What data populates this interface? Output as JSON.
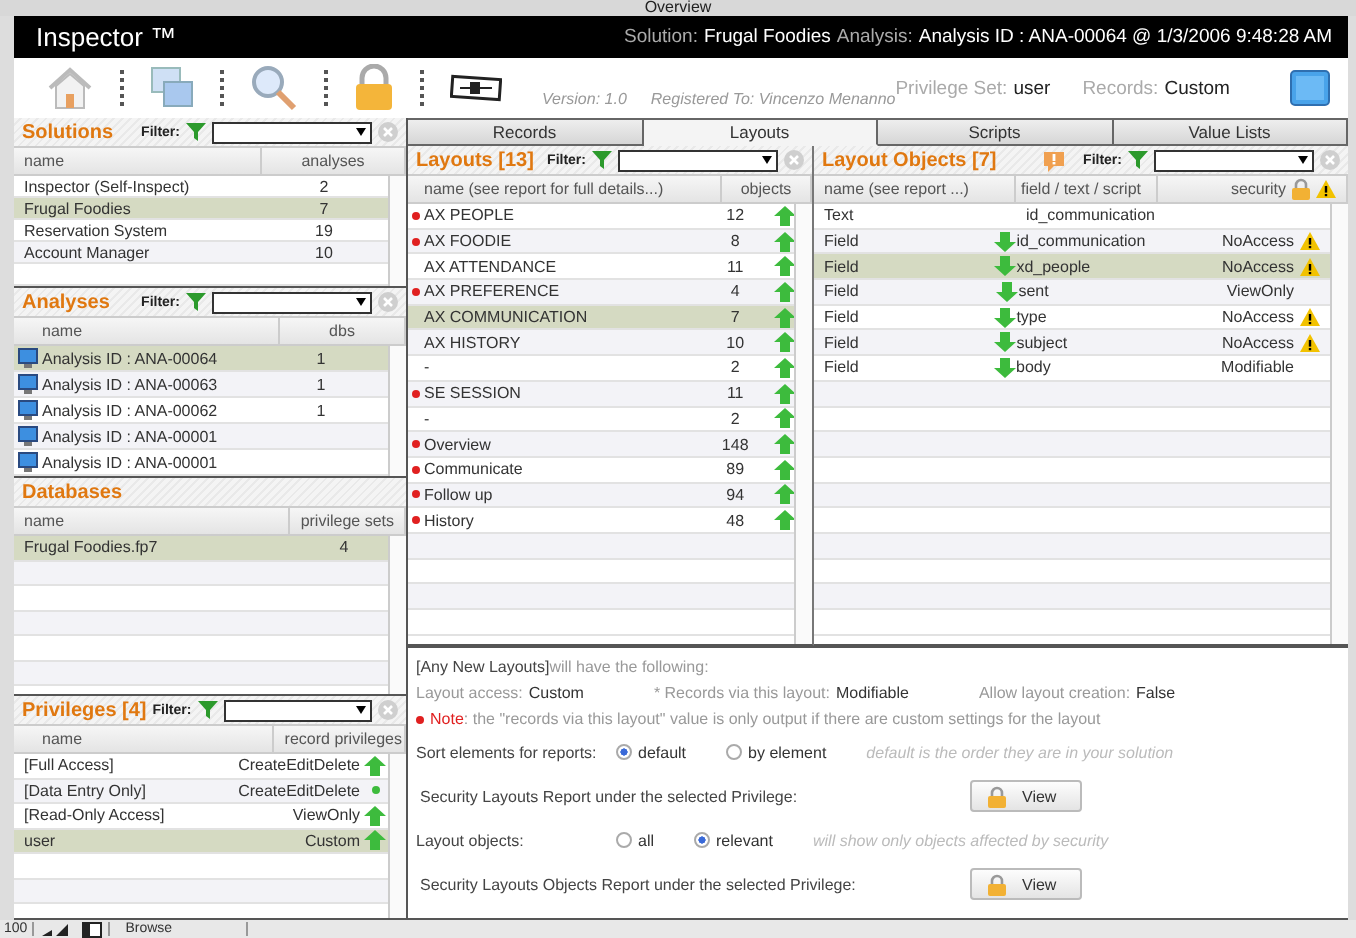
{
  "window": {
    "title": "Overview"
  },
  "header": {
    "app_title": "Inspector ™",
    "solution_label": "Solution:",
    "solution": "Frugal Foodies",
    "analysis_label": "Analysis:",
    "analysis": "Analysis ID : ANA-00064 @ 1/3/2006 9:48:28 AM"
  },
  "toolbar": {
    "version": "Version: 1.0",
    "registered": "Registered To: Vincenzo Menanno",
    "privilege_set_label": "Privilege Set:",
    "privilege_set": "user",
    "records_label": "Records:",
    "records": "Custom"
  },
  "solutions": {
    "title": "Solutions",
    "filter_label": "Filter:",
    "columns": [
      "name",
      "analyses"
    ],
    "rows": [
      {
        "name": "Inspector (Self-Inspect)",
        "count": "2",
        "selected": false
      },
      {
        "name": "Frugal Foodies",
        "count": "7",
        "selected": true
      },
      {
        "name": "Reservation System",
        "count": "19",
        "selected": false
      },
      {
        "name": "Account Manager",
        "count": "10",
        "selected": false
      }
    ]
  },
  "analyses": {
    "title": "Analyses",
    "filter_label": "Filter:",
    "columns": [
      "name",
      "dbs"
    ],
    "rows": [
      {
        "name": "Analysis ID : ANA-00064",
        "count": "1",
        "selected": true
      },
      {
        "name": "Analysis ID : ANA-00063",
        "count": "1",
        "selected": false
      },
      {
        "name": "Analysis ID : ANA-00062",
        "count": "1",
        "selected": false
      },
      {
        "name": "Analysis ID : ANA-00001",
        "selected": false
      },
      {
        "name": "Analysis ID : ANA-00001",
        "selected": false
      }
    ]
  },
  "databases": {
    "title": "Databases",
    "columns": [
      "name",
      "privilege sets"
    ],
    "rows": [
      {
        "name": "Frugal Foodies.fp7",
        "count": "4",
        "selected": true
      }
    ]
  },
  "privileges": {
    "title": "Privileges [4]",
    "filter_label": "Filter:",
    "columns": [
      "name",
      "record privileges"
    ],
    "rows": [
      {
        "name": "[Full Access]",
        "value": "CreateEditDelete",
        "kind": "arrow",
        "selected": false
      },
      {
        "name": "[Data Entry Only]",
        "value": "CreateEditDelete",
        "kind": "dot",
        "selected": false
      },
      {
        "name": "[Read-Only Access]",
        "value": "ViewOnly",
        "kind": "arrow",
        "selected": false
      },
      {
        "name": "user",
        "value": "Custom",
        "kind": "arrow",
        "selected": true
      }
    ]
  },
  "tabs": [
    {
      "label": "Records",
      "selected": false
    },
    {
      "label": "Layouts",
      "selected": true
    },
    {
      "label": "Scripts",
      "selected": false
    },
    {
      "label": "Value Lists",
      "selected": false
    }
  ],
  "layouts": {
    "title": "Layouts [13]",
    "filter_label": "Filter:",
    "columns": [
      "name (see report for full details...)",
      "objects"
    ],
    "rows": [
      {
        "name": "AX PEOPLE",
        "objects": "12",
        "flagged": true,
        "selected": false
      },
      {
        "name": "AX FOODIE",
        "objects": "8",
        "flagged": true,
        "selected": false
      },
      {
        "name": "AX ATTENDANCE",
        "objects": "11",
        "flagged": false,
        "selected": false
      },
      {
        "name": "AX PREFERENCE",
        "objects": "4",
        "flagged": true,
        "selected": false
      },
      {
        "name": "AX COMMUNICATION",
        "objects": "7",
        "flagged": false,
        "selected": true
      },
      {
        "name": "AX HISTORY",
        "objects": "10",
        "flagged": false,
        "selected": false
      },
      {
        "name": "-",
        "objects": "2",
        "flagged": false,
        "selected": false
      },
      {
        "name": "SE SESSION",
        "objects": "11",
        "flagged": true,
        "selected": false
      },
      {
        "name": "-",
        "objects": "2",
        "flagged": false,
        "selected": false
      },
      {
        "name": "Overview",
        "objects": "148",
        "flagged": true,
        "selected": false
      },
      {
        "name": "Communicate",
        "objects": "89",
        "flagged": true,
        "selected": false
      },
      {
        "name": "Follow up",
        "objects": "94",
        "flagged": true,
        "selected": false
      },
      {
        "name": "History",
        "objects": "48",
        "flagged": true,
        "selected": false
      }
    ]
  },
  "layout_objects": {
    "title": "Layout Objects [7]",
    "filter_label": "Filter:",
    "columns": [
      "name (see report ...)",
      "field / text / script",
      "security"
    ],
    "rows": [
      {
        "type": "Text",
        "name": "id_communication",
        "linked": false,
        "warning": false,
        "selected": false
      },
      {
        "type": "Field",
        "name": "id_communication",
        "security": "NoAccess",
        "linked": true,
        "warning": true,
        "selected": false
      },
      {
        "type": "Field",
        "name": "xd_people",
        "security": "NoAccess",
        "linked": true,
        "warning": true,
        "selected": true
      },
      {
        "type": "Field",
        "name": "sent",
        "security": "ViewOnly",
        "linked": true,
        "warning": false,
        "selected": false
      },
      {
        "type": "Field",
        "name": "type",
        "security": "NoAccess",
        "linked": true,
        "warning": true,
        "selected": false
      },
      {
        "type": "Field",
        "name": "subject",
        "security": "NoAccess",
        "linked": true,
        "warning": true,
        "selected": false
      },
      {
        "type": "Field",
        "name": "body",
        "security": "Modifiable",
        "linked": true,
        "warning": false,
        "selected": false
      }
    ]
  },
  "info": {
    "heading": "[Any New Layouts]",
    "heading_rest": " will have the following:",
    "settings": [
      {
        "label": "Layout access:",
        "value": "Custom"
      },
      {
        "label": "* Records via this layout:",
        "value": "Modifiable"
      },
      {
        "label": "Allow layout creation:",
        "value": "False"
      }
    ],
    "note_label": "Note",
    "note_text": ": the \"records via this layout\" value is only output if there are custom settings for the layout",
    "sort": {
      "label": "Sort elements for reports:",
      "options": [
        {
          "label": "default",
          "selected": true
        },
        {
          "label": "by element",
          "selected": false
        }
      ],
      "hint": "default is the order they are in your solution"
    },
    "layouts_report": {
      "label": "Security Layouts Report under the selected Privilege:",
      "button": "View"
    },
    "objects": {
      "label": "Layout objects:",
      "options": [
        {
          "label": "all",
          "selected": false
        },
        {
          "label": "relevant",
          "selected": true
        }
      ],
      "hint": "will show only objects affected by security"
    },
    "objects_report": {
      "label": "Security Layouts Objects Report under the selected Privilege:",
      "button": "View"
    }
  },
  "status_bar": {
    "zoom": "100",
    "mode": "Browse"
  }
}
